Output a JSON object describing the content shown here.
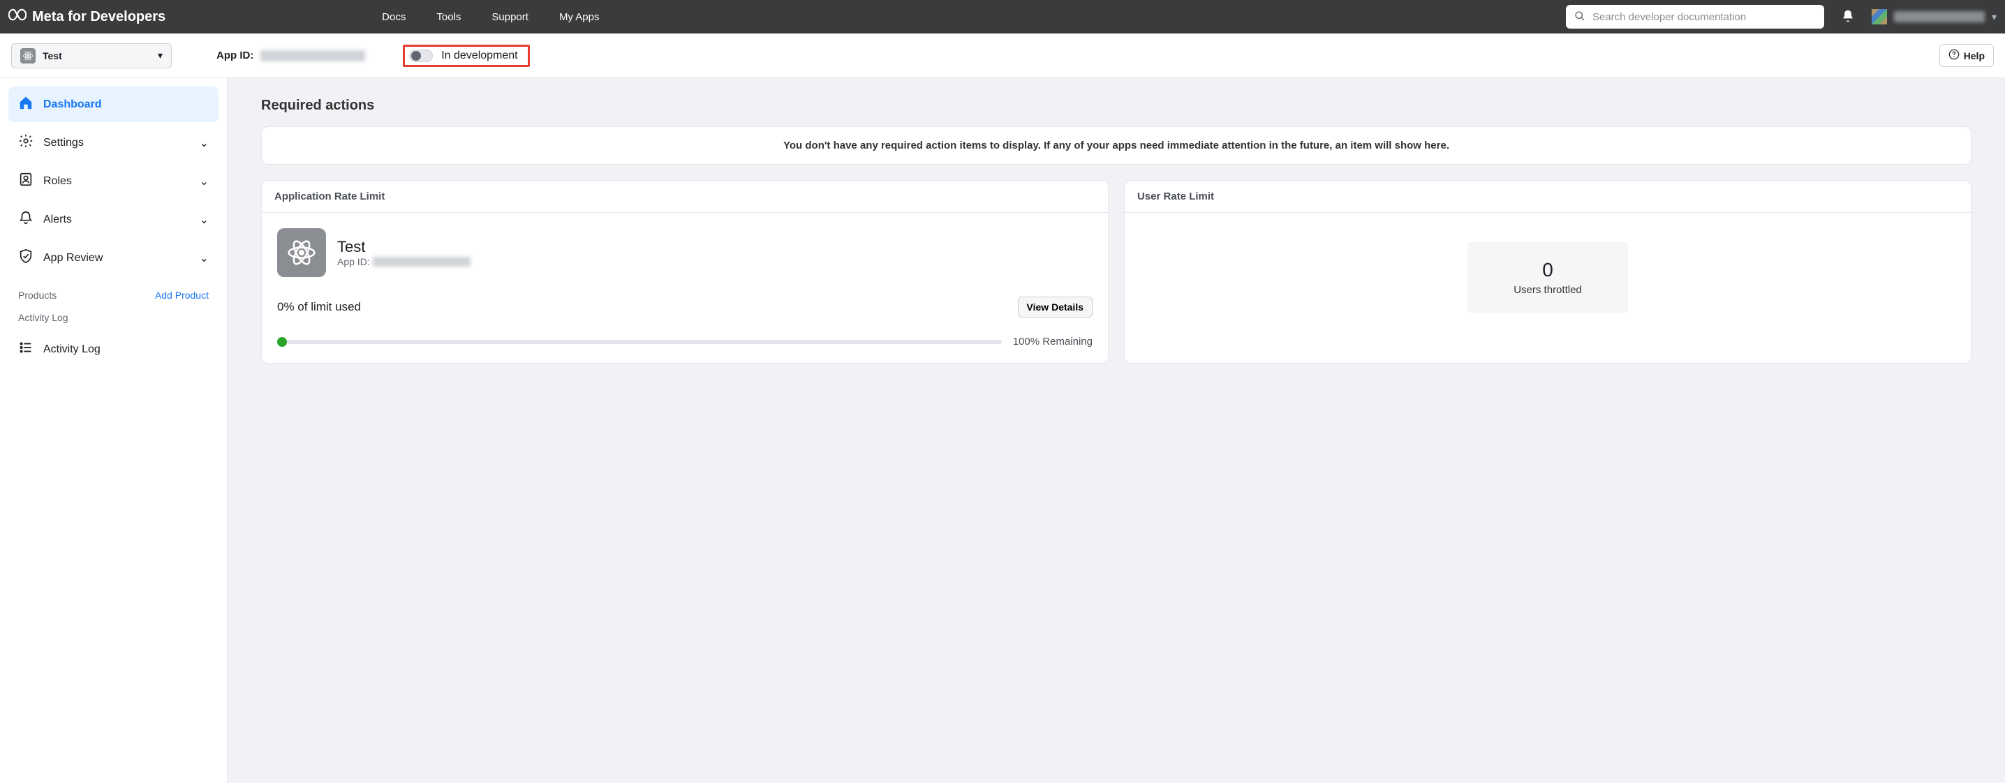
{
  "topnav": {
    "brand": "Meta for Developers",
    "links": {
      "docs": "Docs",
      "tools": "Tools",
      "support": "Support",
      "myapps": "My Apps"
    },
    "search_placeholder": "Search developer documentation"
  },
  "subheader": {
    "app_name": "Test",
    "app_id_label": "App ID:",
    "dev_mode_label": "In development",
    "help_label": "Help"
  },
  "sidebar": {
    "dashboard": "Dashboard",
    "settings": "Settings",
    "roles": "Roles",
    "alerts": "Alerts",
    "app_review": "App Review",
    "products_heading": "Products",
    "add_product": "Add Product",
    "activity_log_heading": "Activity Log",
    "activity_log": "Activity Log"
  },
  "content": {
    "required_actions_title": "Required actions",
    "required_actions_empty": "You don't have any required action items to display. If any of your apps need immediate attention in the future, an item will show here.",
    "app_rate_limit": {
      "title": "Application Rate Limit",
      "app_name": "Test",
      "app_id_label": "App ID:",
      "limit_used_text": "0% of limit used",
      "view_details": "View Details",
      "remaining_text": "100% Remaining"
    },
    "user_rate_limit": {
      "title": "User Rate Limit",
      "count": "0",
      "label": "Users throttled"
    }
  }
}
